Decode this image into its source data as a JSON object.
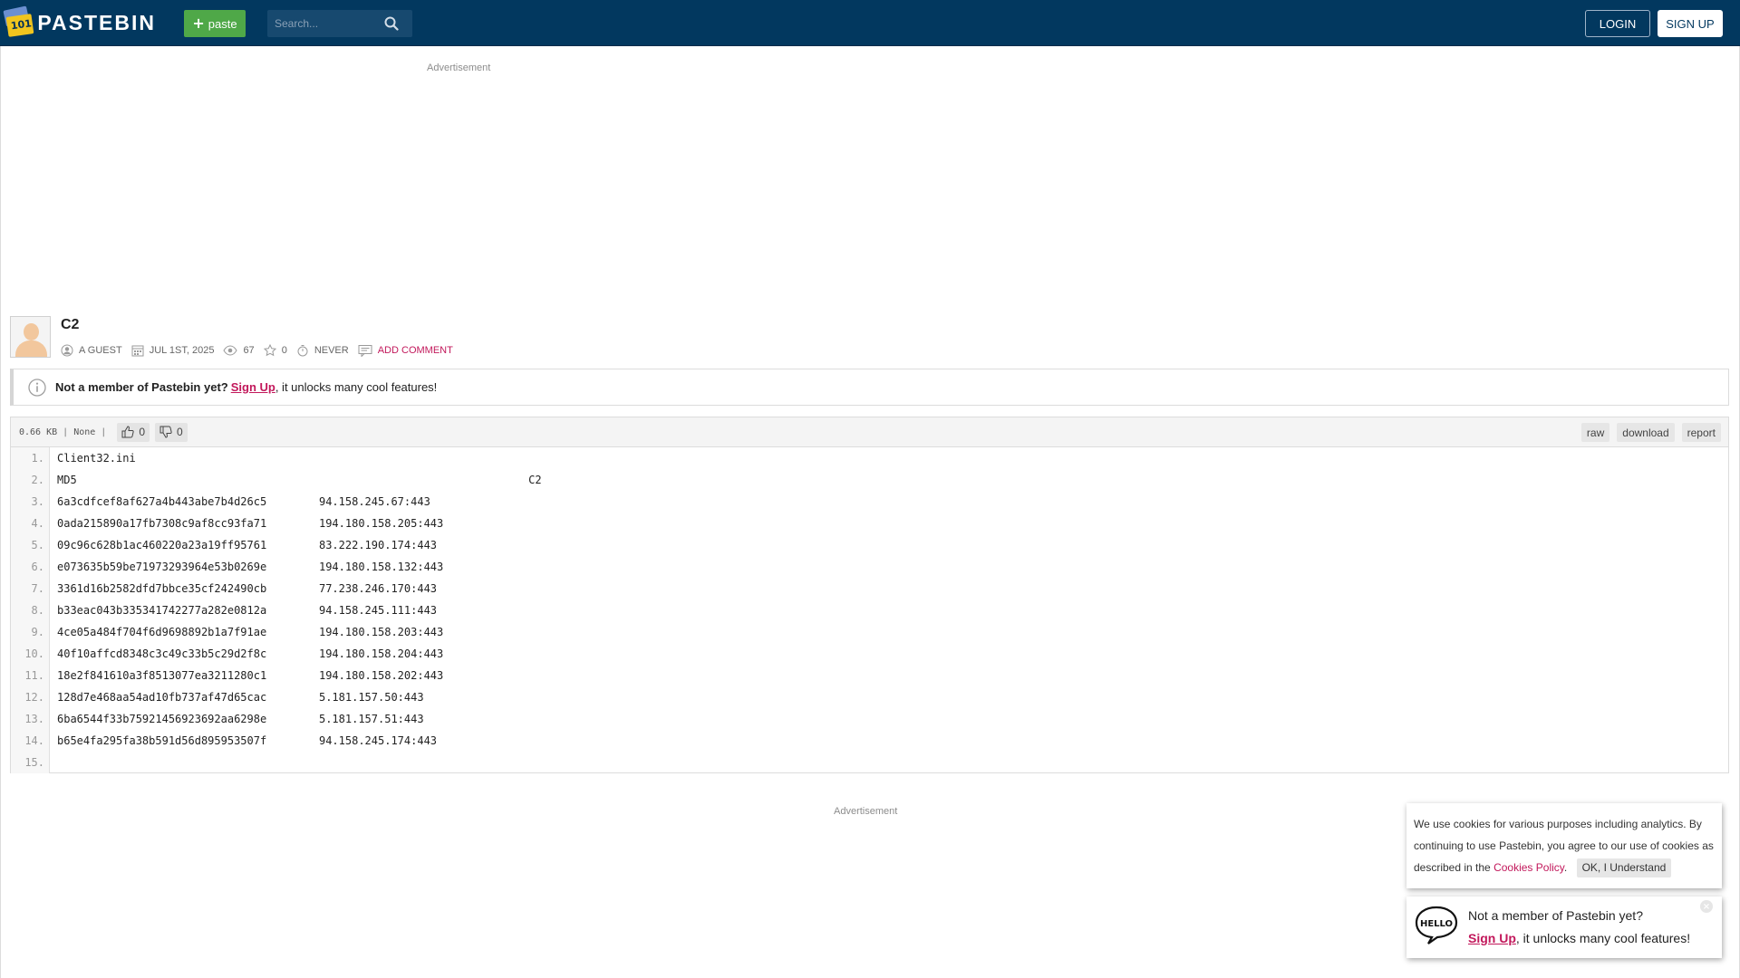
{
  "header": {
    "logo_text": "PASTEBIN",
    "logo_badge": "101",
    "paste_button": "paste",
    "search_placeholder": "Search...",
    "login": "LOGIN",
    "signup": "SIGN UP"
  },
  "ads": {
    "top_label": "Advertisement",
    "bottom_label": "Advertisement"
  },
  "paste": {
    "title": "C2",
    "author": "A GUEST",
    "date": "JUL 1ST, 2025",
    "views": "67",
    "stars": "0",
    "expiry": "NEVER",
    "add_comment": "ADD COMMENT"
  },
  "notice": {
    "bold": "Not a member of Pastebin yet?",
    "signup": "Sign Up",
    "rest": ", it unlocks many cool features!"
  },
  "code": {
    "size": "0.66 KB",
    "syntax": "None",
    "likes": "0",
    "dislikes": "0",
    "buttons": {
      "raw": "raw",
      "download": "download",
      "report": "report"
    },
    "lines": [
      "Client32.ini",
      "MD5                                                                     C2",
      "6a3cdfcef8af627a4b443abe7b4d26c5        94.158.245.67:443",
      "0ada215890a17fb7308c9af8cc93fa71        194.180.158.205:443",
      "09c96c628b1ac460220a23a19ff95761        83.222.190.174:443",
      "e073635b59be71973293964e53b0269e        194.180.158.132:443",
      "3361d16b2582dfd7bbce35cf242490cb        77.238.246.170:443",
      "b33eac043b335341742277a282e0812a        94.158.245.111:443",
      "4ce05a484f704f6d9698892b1a7f91ae        194.180.158.203:443",
      "40f10affcd8348c3c49c33b5c29d2f8c        194.180.158.204:443",
      "18e2f841610a3f8513077ea3211280c1        194.180.158.202:443",
      "128d7e468aa54ad10fb737af47d65cac        5.181.157.50:443",
      "6ba6544f33b75921456923692aa6298e        5.181.157.51:443",
      "b65e4fa295fa38b591d56d895953507f        94.158.245.174:443",
      ""
    ]
  },
  "cookie": {
    "text": "We use cookies for various purposes including analytics. By continuing to use Pastebin, you agree to our use of cookies as described in the",
    "policy_link": "Cookies Policy",
    "period": ".",
    "ok_button": "OK, I Understand"
  },
  "member_popup": {
    "line1": "Not a member of Pastebin yet?",
    "signup": "Sign Up",
    "line2_rest": ", it unlocks many cool features!",
    "hello_art": "HELLO"
  },
  "colors": {
    "header_bg": "#02385f",
    "paste_button": "#4fa848",
    "accent_link": "#c2185b"
  }
}
